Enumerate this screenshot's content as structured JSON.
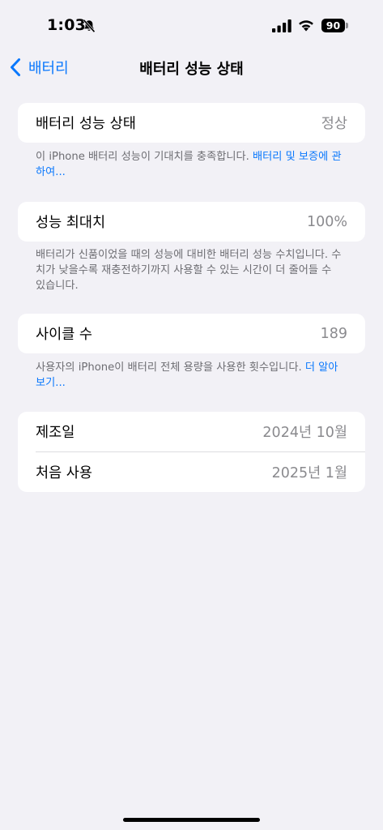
{
  "status_bar": {
    "time": "1:03",
    "battery_level": "90"
  },
  "nav": {
    "back_label": "배터리",
    "title": "배터리 성능 상태"
  },
  "section_health": {
    "label": "배터리 성능 상태",
    "value": "정상",
    "footnote_text": "이 iPhone 배터리 성능이 기대치를 충족합니다. ",
    "footnote_link": "배터리 및 보증에 관하여..."
  },
  "section_capacity": {
    "label": "성능 최대치",
    "value": "100%",
    "footnote_text": "배터리가 신품이었을 때의 성능에 대비한 배터리 성능 수치입니다. 수치가 낮을수록 재충전하기까지 사용할 수 있는 시간이 더 줄어들 수 있습니다."
  },
  "section_cycles": {
    "label": "사이클 수",
    "value": "189",
    "footnote_text": "사용자의 iPhone이 배터리 전체 용량을 사용한 횟수입니다. ",
    "footnote_link": "더 알아보기..."
  },
  "section_dates": {
    "manufacture_label": "제조일",
    "manufacture_value": "2024년 10월",
    "first_use_label": "처음 사용",
    "first_use_value": "2025년 1월"
  },
  "colors": {
    "accent": "#0a78fd",
    "background": "#f2f1f6",
    "secondary_text": "#8a8a8e"
  }
}
